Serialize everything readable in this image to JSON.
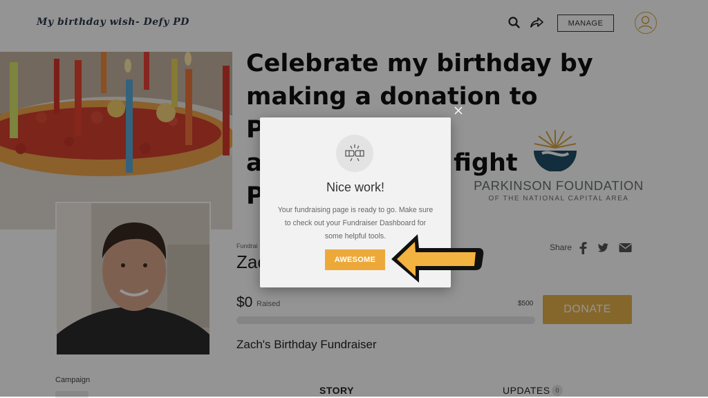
{
  "header": {
    "brand": "My birthday wish- Defy PD",
    "manage_label": "MANAGE",
    "icons": [
      "search-icon",
      "share-arrow-icon",
      "user-avatar-icon"
    ]
  },
  "hero": {
    "headline_lines": [
      "Celebrate my birthday by",
      "making a donation to PFNCA",
      "a",
      "fight",
      "P"
    ],
    "logo_name": "PARKINSON FOUNDATION",
    "logo_sub": "OF THE NATIONAL CAPITAL AREA"
  },
  "fundraiser": {
    "small_label": "Fundrai",
    "name_partial": "Zach",
    "share_label": "Share",
    "share_icons": [
      "facebook-icon",
      "twitter-icon",
      "email-icon"
    ],
    "raised_amount": "$0",
    "raised_label": "Raised",
    "goal": "$500",
    "progress_fraction": 0,
    "donate_label": "DONATE",
    "title": "Zach's Birthday Fundraiser"
  },
  "lower": {
    "campaign_label": "Campaign",
    "tab_story": "STORY",
    "tab_updates": "UPDATES",
    "updates_count": "0"
  },
  "modal": {
    "title": "Nice work!",
    "body": "Your fundraising page is ready to go. Make sure to check out your Fundraiser Dashboard for some helpful tools.",
    "button_label": "AWESOME"
  },
  "colors": {
    "accent": "#e7b14a",
    "overlay": "#000000",
    "arrow_fill": "#f2b341"
  }
}
